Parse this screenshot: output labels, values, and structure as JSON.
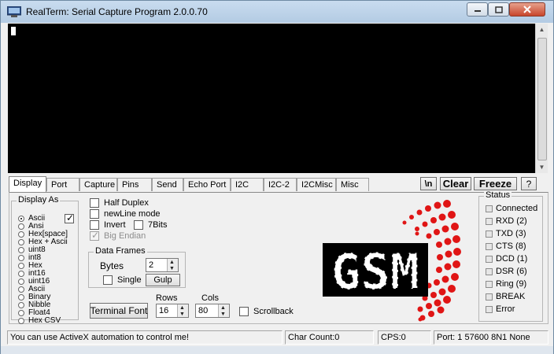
{
  "window": {
    "title": "RealTerm: Serial Capture Program 2.0.0.70"
  },
  "tabs": [
    "Display",
    "Port",
    "Capture",
    "Pins",
    "Send",
    "Echo Port",
    "I2C",
    "I2C-2",
    "I2CMisc",
    "Misc"
  ],
  "toolbar": {
    "newline_label": "\\n",
    "clear_label": "Clear",
    "freeze_label": "Freeze",
    "help_label": "?"
  },
  "display_as": {
    "label": "Display As",
    "selected": "Ascii",
    "options": [
      "Ascii",
      "Ansi",
      "Hex[space]",
      "Hex + Ascii",
      "uint8",
      "int8",
      "Hex",
      "int16",
      "uint16",
      "Ascii",
      "Binary",
      "Nibble",
      "Float4",
      "Hex CSV"
    ]
  },
  "options": {
    "half_duplex": "Half Duplex",
    "newline_mode": "newLine mode",
    "invert": "Invert",
    "seven_bits": "7Bits",
    "big_endian": "Big Endian"
  },
  "data_frames": {
    "label": "Data Frames",
    "bytes_label": "Bytes",
    "bytes_value": "2",
    "single_label": "Single",
    "gulp_label": "Gulp"
  },
  "terminal_font_label": "Terminal Font",
  "rows": {
    "label": "Rows",
    "value": "16"
  },
  "cols": {
    "label": "Cols",
    "value": "80"
  },
  "scrollback_label": "Scrollback",
  "logo": {
    "text": "GSM",
    "accent": "#e01515"
  },
  "status": {
    "label": "Status",
    "items": [
      "Connected",
      "RXD (2)",
      "TXD (3)",
      "CTS (8)",
      "DCD (1)",
      "DSR (6)",
      "Ring (9)",
      "BREAK",
      "Error"
    ]
  },
  "statusbar": {
    "message": "You can use ActiveX automation to control me!",
    "char_count": "Char Count:0",
    "cps": "CPS:0",
    "port": "Port: 1 57600 8N1 None"
  }
}
